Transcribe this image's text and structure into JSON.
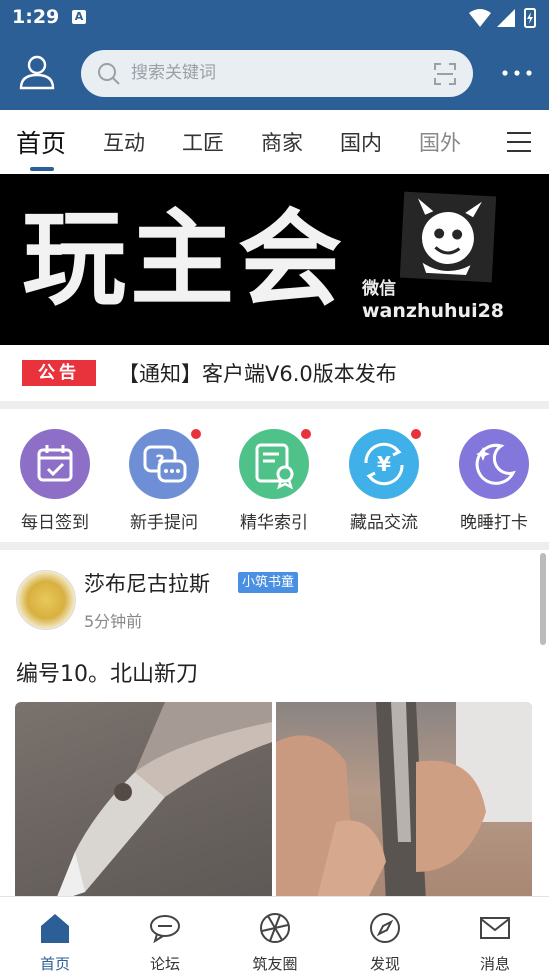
{
  "status_bar": {
    "time": "1:29",
    "notif_icon": "A"
  },
  "header": {
    "search_placeholder": "搜索关键词"
  },
  "tabs": [
    {
      "label": "首页",
      "active": true
    },
    {
      "label": "互动"
    },
    {
      "label": "工匠"
    },
    {
      "label": "商家"
    },
    {
      "label": "国内"
    },
    {
      "label": "国外"
    }
  ],
  "banner": {
    "headline": "玩主会",
    "wechat": "微信",
    "handle": "wanzhuhui28"
  },
  "notice": {
    "tag": "公告",
    "text": "【通知】客户端V6.0版本发布"
  },
  "quick_links": [
    {
      "label": "每日签到",
      "color": "#8e6fc8",
      "icon": "calendar-check-icon",
      "dot": false
    },
    {
      "label": "新手提问",
      "color": "#6e8ed6",
      "icon": "chat-question-icon",
      "dot": true
    },
    {
      "label": "精华索引",
      "color": "#4fc28a",
      "icon": "certificate-icon",
      "dot": true
    },
    {
      "label": "藏品交流",
      "color": "#3fb0e8",
      "icon": "yen-exchange-icon",
      "dot": true
    },
    {
      "label": "晚睡打卡",
      "color": "#8477dc",
      "icon": "moon-icon",
      "dot": false
    }
  ],
  "post": {
    "author": "莎布尼古拉斯",
    "badge": "小筑书童",
    "time": "5分钟前",
    "title": "编号10。北山新刀"
  },
  "bottom_nav": [
    {
      "label": "首页",
      "active": true
    },
    {
      "label": "论坛"
    },
    {
      "label": "筑友圈"
    },
    {
      "label": "发现"
    },
    {
      "label": "消息"
    }
  ],
  "colors": {
    "brand": "#2b5f95",
    "alert": "#e8323c"
  }
}
